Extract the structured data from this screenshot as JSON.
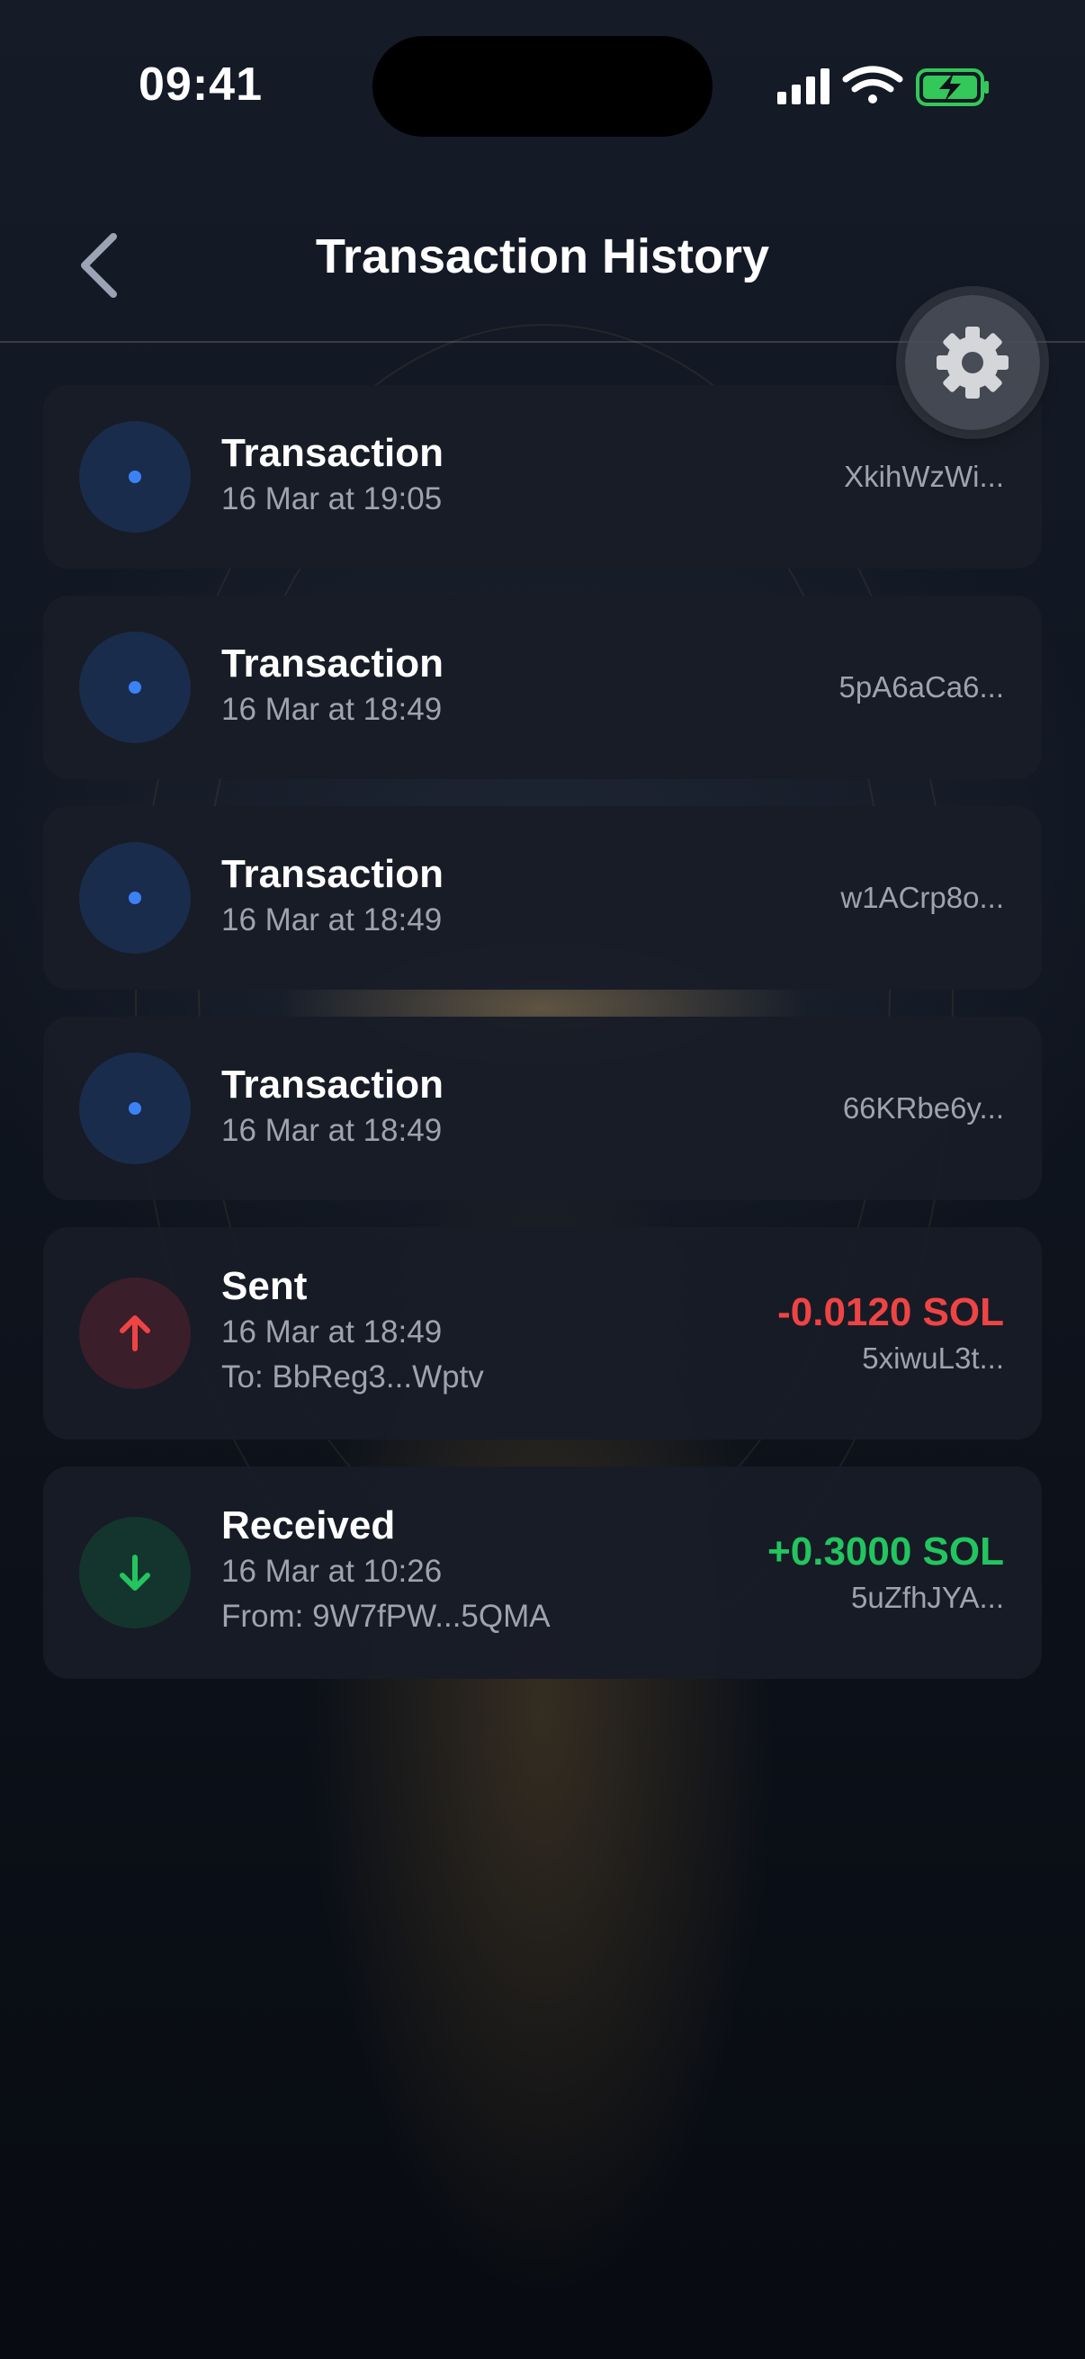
{
  "status_bar": {
    "time": "09:41"
  },
  "header": {
    "title": "Transaction History",
    "back_icon": "chevron-left-icon",
    "settings_icon": "gear-icon"
  },
  "transactions": [
    {
      "title": "Transaction",
      "date": "16 Mar at 19:05",
      "hash": "XkihWzWi...",
      "kind": "neutral"
    },
    {
      "title": "Transaction",
      "date": "16 Mar at 18:49",
      "hash": "5pA6aCa6...",
      "kind": "neutral"
    },
    {
      "title": "Transaction",
      "date": "16 Mar at 18:49",
      "hash": "w1ACrp8o...",
      "kind": "neutral"
    },
    {
      "title": "Transaction",
      "date": "16 Mar at 18:49",
      "hash": "66KRbe6y...",
      "kind": "neutral"
    },
    {
      "title": "Sent",
      "date": "16 Mar at 18:49",
      "counterparty": "To: BbReg3...Wptv",
      "amount": "-0.0120 SOL",
      "hash": "5xiwuL3t...",
      "kind": "sent"
    },
    {
      "title": "Received",
      "date": "16 Mar at 10:26",
      "counterparty": "From: 9W7fPW...5QMA",
      "amount": "+0.3000 SOL",
      "hash": "5uZfhJYA...",
      "kind": "received"
    }
  ],
  "colors": {
    "accent_blue": "#3b82f6",
    "sent_red": "#ef4444",
    "received_green": "#22c55e",
    "battery_green": "#34c759"
  }
}
